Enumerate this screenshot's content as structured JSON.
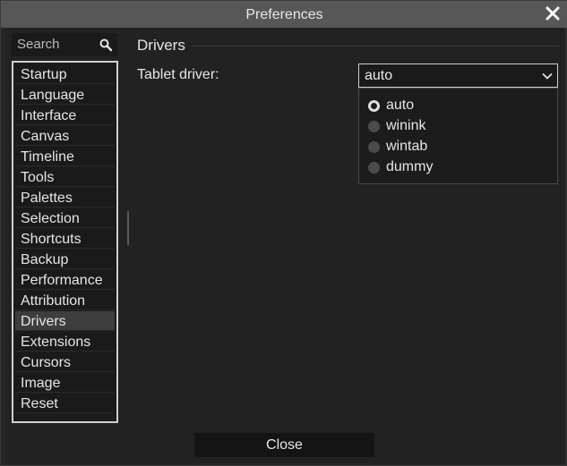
{
  "window": {
    "title": "Preferences"
  },
  "search": {
    "placeholder": "Search"
  },
  "sidebar": {
    "items": [
      {
        "label": "Startup"
      },
      {
        "label": "Language"
      },
      {
        "label": "Interface"
      },
      {
        "label": "Canvas"
      },
      {
        "label": "Timeline"
      },
      {
        "label": "Tools"
      },
      {
        "label": "Palettes"
      },
      {
        "label": "Selection"
      },
      {
        "label": "Shortcuts"
      },
      {
        "label": "Backup"
      },
      {
        "label": "Performance"
      },
      {
        "label": "Attribution"
      },
      {
        "label": "Drivers",
        "selected": true
      },
      {
        "label": "Extensions"
      },
      {
        "label": "Cursors"
      },
      {
        "label": "Image"
      },
      {
        "label": "Reset"
      }
    ]
  },
  "drivers": {
    "section_title": "Drivers",
    "tablet_driver_label": "Tablet driver:",
    "tablet_driver_value": "auto",
    "options": [
      {
        "label": "auto",
        "checked": true
      },
      {
        "label": "winink",
        "checked": false
      },
      {
        "label": "wintab",
        "checked": false
      },
      {
        "label": "dummy",
        "checked": false
      }
    ]
  },
  "footer": {
    "close_label": "Close"
  },
  "icons": {
    "close": "close-icon",
    "search": "search-icon",
    "dropdown": "chevron-down-icon"
  }
}
